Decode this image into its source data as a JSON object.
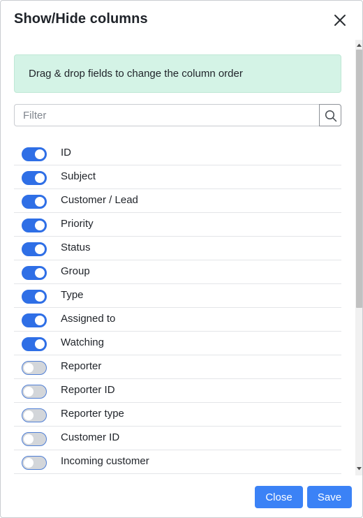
{
  "dialog": {
    "title": "Show/Hide columns",
    "hint": "Drag & drop fields to change the column order",
    "filter_placeholder": "Filter",
    "filter_value": ""
  },
  "columns": [
    {
      "label": "ID",
      "enabled": true
    },
    {
      "label": "Subject",
      "enabled": true
    },
    {
      "label": "Customer / Lead",
      "enabled": true
    },
    {
      "label": "Priority",
      "enabled": true
    },
    {
      "label": "Status",
      "enabled": true
    },
    {
      "label": "Group",
      "enabled": true
    },
    {
      "label": "Type",
      "enabled": true
    },
    {
      "label": "Assigned to",
      "enabled": true
    },
    {
      "label": "Watching",
      "enabled": true
    },
    {
      "label": "Reporter",
      "enabled": false
    },
    {
      "label": "Reporter ID",
      "enabled": false
    },
    {
      "label": "Reporter type",
      "enabled": false
    },
    {
      "label": "Customer ID",
      "enabled": false
    },
    {
      "label": "Incoming customer",
      "enabled": false
    }
  ],
  "footer": {
    "close_label": "Close",
    "save_label": "Save"
  },
  "icons": {
    "close": "close-icon",
    "search": "search-icon"
  },
  "colors": {
    "accent": "#3b82f6",
    "toggle_on": "#2f6fe6",
    "toggle_off": "#d3d6da",
    "hint_bg": "#d4f3e6"
  }
}
